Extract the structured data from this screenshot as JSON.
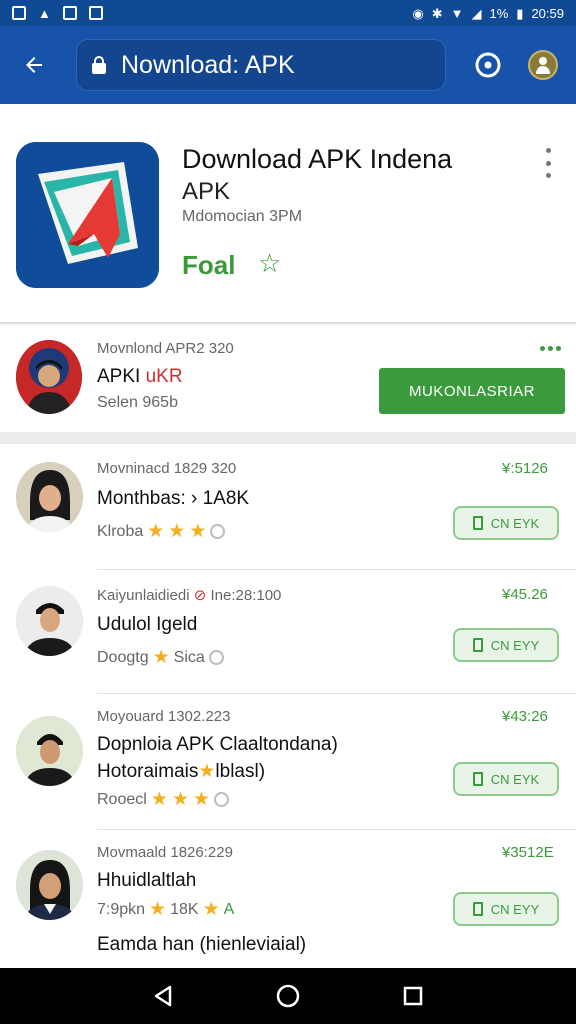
{
  "status_bar": {
    "battery": "1%",
    "time": "20:59"
  },
  "app_bar": {
    "url": "Nownload: APK"
  },
  "hero": {
    "title": "Download APK Indena",
    "subtitle": "APK",
    "meta": "Mdomocian 3PM",
    "price": "Foal"
  },
  "featured": {
    "line1": "Movnlond APR2 320",
    "title_black": "APKI ",
    "title_red": "uKR",
    "line3": "Selen 965b",
    "button_label": "MUKONLASRIAR"
  },
  "list": [
    {
      "meta": "Movninacd 1829 320",
      "title": "Monthbas: › 1A8K",
      "rating_text": "Klroba",
      "stars": 3,
      "price": "¥:5126",
      "button_label": "CN EYK"
    },
    {
      "meta": "Kaiyunlaidiedi",
      "meta2": "Ine:28:100",
      "title": "Udulol Igeld",
      "rating_text": "Doogtg",
      "stars": 1,
      "rating_tail": "Sica",
      "price": "¥45.26",
      "button_label": "CN EYY"
    },
    {
      "meta": "Moyouard 1302.223",
      "title": "Dopnloia APK Claaltondana)",
      "title2": "Hotoraimais",
      "title2_tail": "lblasl)",
      "rating_text": "Rooecl",
      "stars": 3,
      "price": "¥43:26",
      "button_label": "CN EYK"
    },
    {
      "meta": "Movmaald 1826:229",
      "title": "Hhuidlaltlah",
      "rating_text": "7:9pkn",
      "rating_mid": "18K",
      "rating_tail": "A",
      "stars": 1,
      "price": "¥3512E",
      "button_label": "CN EYY"
    }
  ],
  "footer_text": "Eamda han (hienleviaial)",
  "colors": {
    "app_bar": "#1753a8",
    "status_bar": "#114a94",
    "accent_green": "#3a9a3a",
    "star": "#f2b01e"
  }
}
